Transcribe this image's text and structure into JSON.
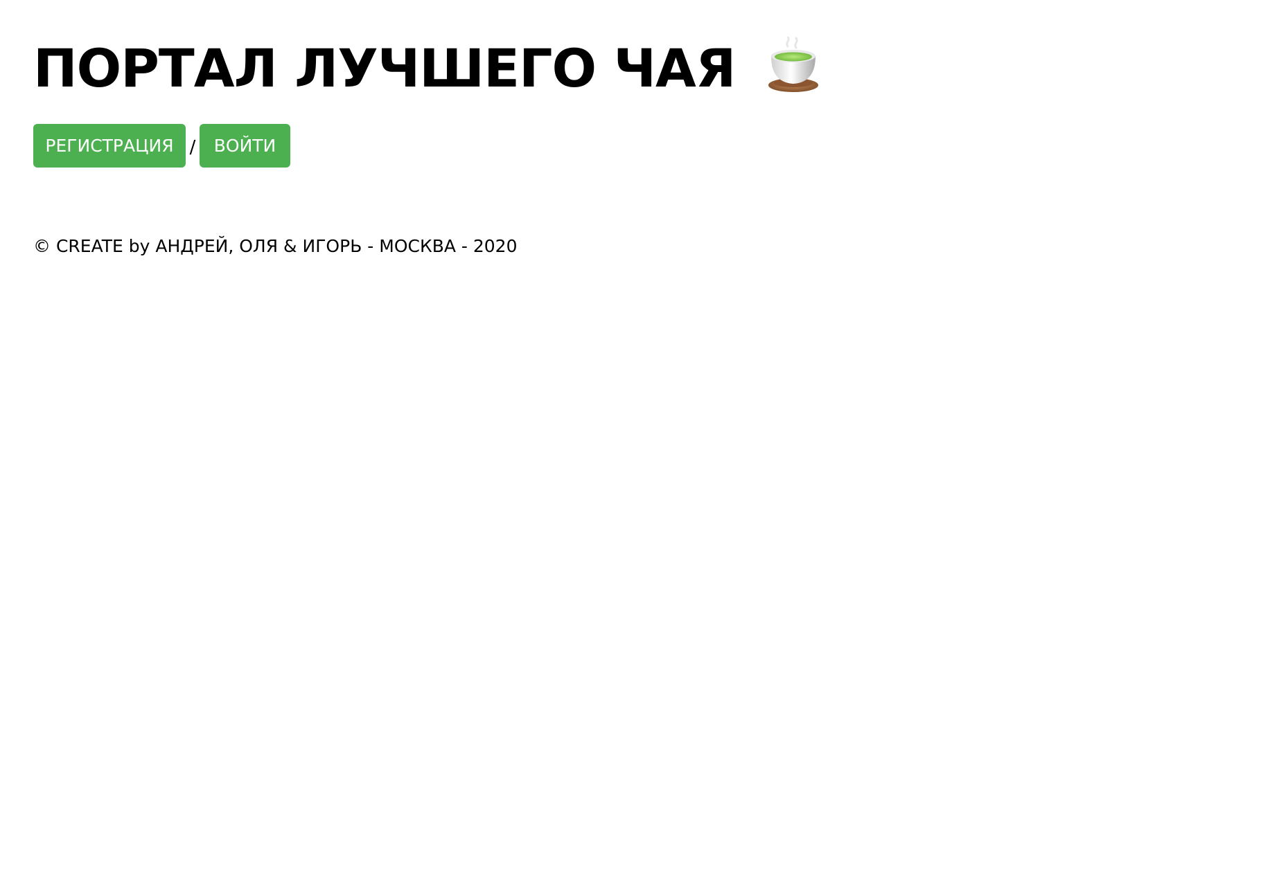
{
  "header": {
    "title": "ПОРТАЛ ЛУЧШЕГО ЧАЯ",
    "title_icon": "teacup-icon"
  },
  "auth": {
    "register_label": "РЕГИСТРАЦИЯ",
    "separator": "/",
    "login_label": "ВОЙТИ"
  },
  "footer": {
    "text": "© CREATE by АНДРЕЙ, ОЛЯ & ИГОРЬ - МОСКВА - 2020"
  },
  "colors": {
    "background": "#ffffff",
    "button": "#4caf50",
    "button_text": "#ffffff",
    "text": "#000000"
  }
}
